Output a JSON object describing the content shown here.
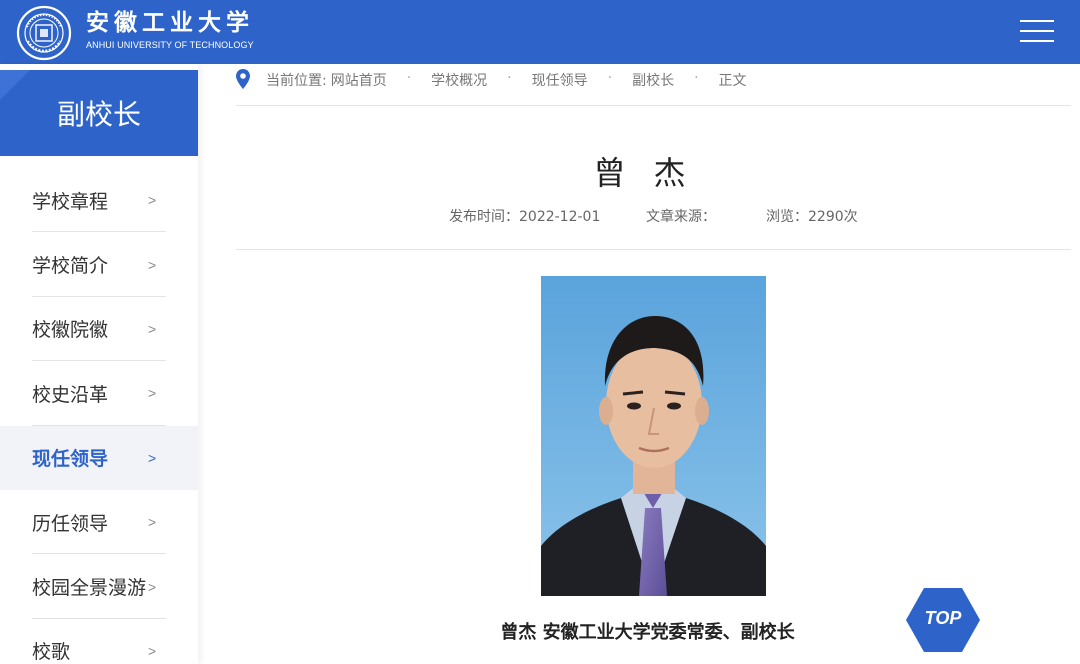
{
  "header": {
    "logo_cn": "安徽工业大学",
    "logo_en": "ANHUI UNIVERSITY OF TECHNOLOGY",
    "seal_text": "ANHUI UNIVERSITY OF TECHNOLOGY",
    "seal_inner": "安徽工业大学",
    "menu_icon": "hamburger-menu-icon",
    "brand_color": "#2e64c9"
  },
  "sidebar": {
    "title": "副校长",
    "items": [
      {
        "label": "学校章程",
        "arrow": ">"
      },
      {
        "label": "学校简介",
        "arrow": ">"
      },
      {
        "label": "校徽院徽",
        "arrow": ">"
      },
      {
        "label": "校史沿革",
        "arrow": ">"
      },
      {
        "label": "现任领导",
        "arrow": ">",
        "active": true
      },
      {
        "label": "历任领导",
        "arrow": ">"
      },
      {
        "label": "校园全景漫游",
        "arrow": ">"
      },
      {
        "label": "校歌",
        "arrow": ">"
      }
    ]
  },
  "breadcrumb": {
    "prefix": "当前位置:",
    "items": [
      "网站首页",
      "学校概况",
      "现任领导",
      "副校长",
      "正文"
    ],
    "separator": "·",
    "icon": "location-pin-icon"
  },
  "article": {
    "title": "曾杰",
    "publish_label": "发布时间：",
    "publish_date": "2022-12-01",
    "source_label": "文章来源：",
    "views_label": "浏览：",
    "views": "2290次",
    "caption": "曾杰 安徽工业大学党委常委、副校长"
  },
  "top_button": {
    "label": "TOP",
    "icon": "hexagon-top-icon"
  }
}
